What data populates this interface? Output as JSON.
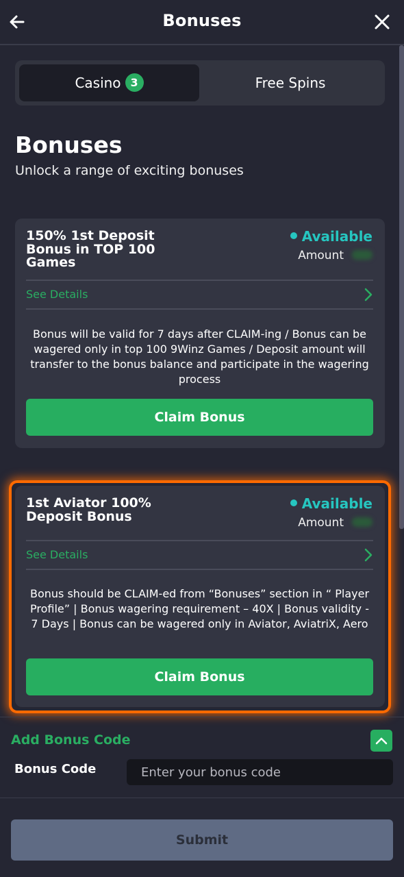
{
  "header": {
    "title": "Bonuses"
  },
  "tabs": [
    {
      "label": "Casino",
      "badge": "3",
      "active": true
    },
    {
      "label": "Free Spins",
      "active": false
    }
  ],
  "page": {
    "title": "Bonuses",
    "subtitle": "Unlock a range of exciting bonuses"
  },
  "bonuses": [
    {
      "title": "150% 1st Deposit Bonus in TOP 100 Games",
      "status": "Available",
      "amount_label": "Amount",
      "details_label": "See Details",
      "description": "Bonus will be valid for 7 days after CLAIM-ing / Bonus can be wagered only in top 100 9Winz Games / Deposit amount will transfer to the bonus balance and participate in the wagering process",
      "claim_label": "Claim Bonus"
    },
    {
      "title": "1st Aviator 100% Deposit Bonus",
      "status": "Available",
      "amount_label": "Amount",
      "details_label": "See Details",
      "description": "Bonus should be CLAIM-ed from “Bonuses” section in “ Player Profile” | Bonus wagering requirement – 40X | Bonus validity - 7 Days | Bonus can be wagered only in Aviator, AviatriX, Aero",
      "claim_label": "Claim Bonus",
      "highlighted": true
    }
  ],
  "bonus_code": {
    "section_label": "Add Bonus Code",
    "field_label": "Bonus Code",
    "placeholder": "Enter your bonus code",
    "value": ""
  },
  "submit_label": "Submit",
  "colors": {
    "background": "#252633",
    "card": "#333542",
    "accent_green": "#27ae60",
    "status_teal": "#26c6c0",
    "highlight_orange": "#ff6a00"
  },
  "icons": [
    "back-arrow-icon",
    "close-icon",
    "chevron-right-icon",
    "chevron-up-icon"
  ]
}
